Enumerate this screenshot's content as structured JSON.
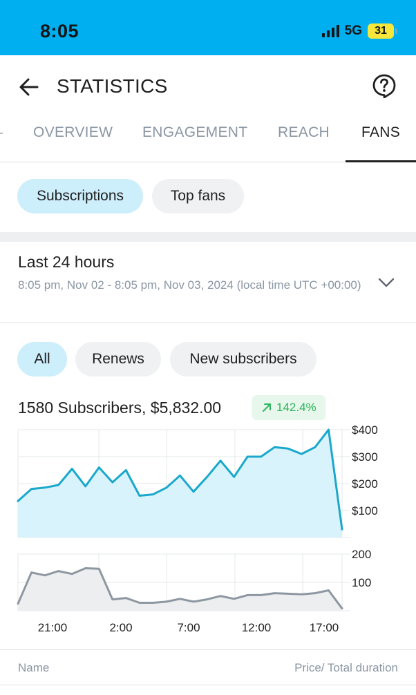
{
  "status_bar": {
    "time": "8:05",
    "network": "5G",
    "battery": "31"
  },
  "header": {
    "title": "STATISTICS",
    "back_icon": "arrow-left-icon",
    "help_icon": "question-circle-icon"
  },
  "tabs": [
    {
      "label": "OVERVIEW",
      "active": false
    },
    {
      "label": "ENGAGEMENT",
      "active": false
    },
    {
      "label": "REACH",
      "active": false
    },
    {
      "label": "FANS",
      "active": true
    }
  ],
  "subtabs": [
    {
      "label": "Subscriptions",
      "active": true
    },
    {
      "label": "Top fans",
      "active": false
    }
  ],
  "range": {
    "title": "Last 24 hours",
    "subtitle": "8:05 pm, Nov 02 - 8:05 pm, Nov 03, 2024 (local time UTC +00:00)",
    "icon": "chevron-down-icon"
  },
  "filters": [
    {
      "label": "All",
      "active": true
    },
    {
      "label": "Renews",
      "active": false
    },
    {
      "label": "New subscribers",
      "active": false
    }
  ],
  "summary": {
    "text": "1580 Subscribers, $5,832.00",
    "growth": "142.4%",
    "growth_icon": "arrow-up-right-icon"
  },
  "colors": {
    "accent": "#00aff0",
    "line": "#19a8cc",
    "fill": "#d9f3fc",
    "count_line": "#8e97a1",
    "count_fill": "#eceef0",
    "positive": "#2fb55c"
  },
  "chart_data": [
    {
      "type": "area",
      "name": "earnings",
      "ylim": [
        0,
        400
      ],
      "yticks": [
        "$400",
        "$300",
        "$200",
        "$100"
      ],
      "x_ticks": [
        "21:00",
        "2:00",
        "7:00",
        "12:00",
        "17:00"
      ],
      "values": [
        135,
        180,
        185,
        195,
        255,
        190,
        260,
        205,
        250,
        155,
        160,
        185,
        230,
        170,
        225,
        285,
        225,
        300,
        300,
        335,
        330,
        310,
        335,
        400,
        30
      ]
    },
    {
      "type": "area",
      "name": "subscribers",
      "ylim": [
        0,
        200
      ],
      "yticks": [
        "200",
        "100"
      ],
      "x_ticks": [
        "21:00",
        "2:00",
        "7:00",
        "12:00",
        "17:00"
      ],
      "values": [
        25,
        135,
        125,
        140,
        130,
        150,
        148,
        40,
        45,
        28,
        28,
        32,
        42,
        32,
        40,
        52,
        42,
        55,
        55,
        62,
        60,
        58,
        62,
        72,
        8
      ]
    }
  ],
  "list_header": {
    "name": "Name",
    "price": "Price/ Total duration"
  }
}
